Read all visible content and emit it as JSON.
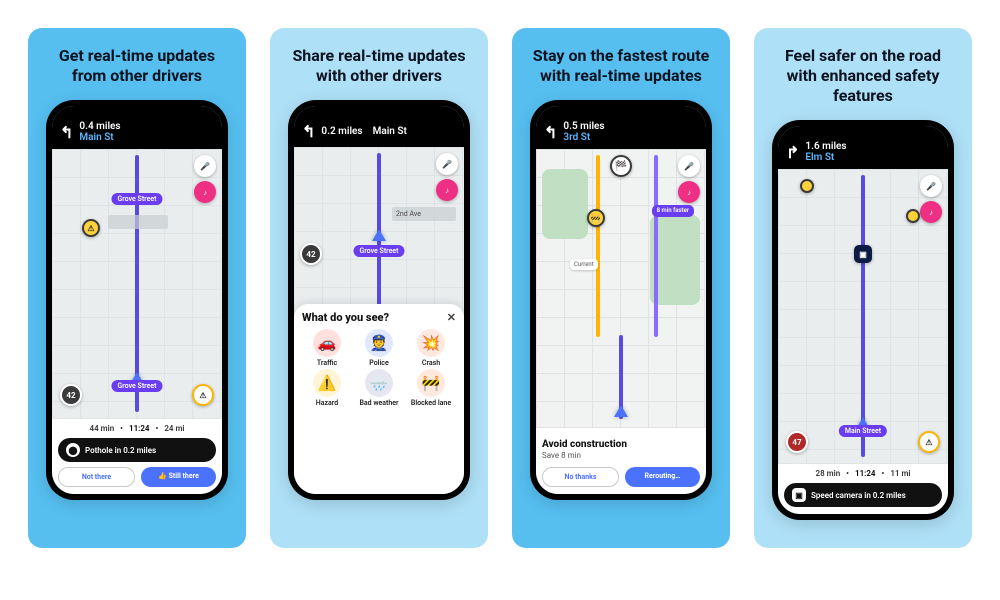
{
  "cards": [
    {
      "headline": "Get real-time updates from other drivers",
      "nav": {
        "arrow": "↰",
        "distance": "0.4 miles",
        "street": "Main St"
      },
      "street_label": "Grove Street",
      "speed": "42",
      "eta": {
        "duration": "44 min",
        "arrival": "11:24",
        "distance": "24 mi"
      },
      "alert": "Pothole in 0.2 miles",
      "buttons": {
        "ghost": "Not there",
        "primary": "👍 Still there"
      }
    },
    {
      "headline": "Share real-time updates with other drivers",
      "nav": {
        "arrow": "↰",
        "distance": "0.2 miles",
        "street": "Main St"
      },
      "street_label": "Grove Street",
      "side_label": "2nd Ave",
      "speed": "42",
      "sheet_title": "What do you see?",
      "reports": [
        {
          "key": "traffic",
          "label": "Traffic",
          "emoji": "🚗"
        },
        {
          "key": "police",
          "label": "Police",
          "emoji": "👮"
        },
        {
          "key": "crash",
          "label": "Crash",
          "emoji": "💥"
        },
        {
          "key": "hazard",
          "label": "Hazard",
          "emoji": "⚠️"
        },
        {
          "key": "weather",
          "label": "Bad weather",
          "emoji": "🌧️"
        },
        {
          "key": "lane",
          "label": "Blocked lane",
          "emoji": "🚧"
        }
      ]
    },
    {
      "headline": "Stay on the fastest route with real-time updates",
      "nav": {
        "arrow": "↰",
        "distance": "0.5 miles",
        "street": "3rd St"
      },
      "faster_label": "8 min faster",
      "current_label": "Current",
      "prompt": {
        "title": "Avoid construction",
        "subtitle": "Save 8 min"
      },
      "buttons": {
        "ghost": "No thanks",
        "primary": "Rerouting…"
      }
    },
    {
      "headline": "Feel safer on the road with enhanced safety features",
      "nav": {
        "arrow": "↱",
        "distance": "1.6 miles",
        "street": "Elm St"
      },
      "street_label": "Main Street",
      "speed": "47",
      "eta": {
        "duration": "28 min",
        "arrival": "11:24",
        "distance": "11 mi"
      },
      "alert": "Speed camera in 0.2 miles"
    }
  ]
}
